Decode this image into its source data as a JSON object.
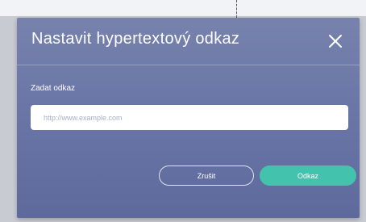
{
  "dialog": {
    "title": "Nastavit hypertextový odkaz",
    "close_icon": "close-icon"
  },
  "link_field": {
    "label": "Zadat odkaz",
    "value": "",
    "placeholder": "http://www.example.com"
  },
  "buttons": {
    "cancel_label": "Zrušit",
    "submit_label": "Odkaz"
  },
  "colors": {
    "dialog_background": "#6a76a6",
    "submit_button": "#43c3ad",
    "text": "#ffffff"
  }
}
